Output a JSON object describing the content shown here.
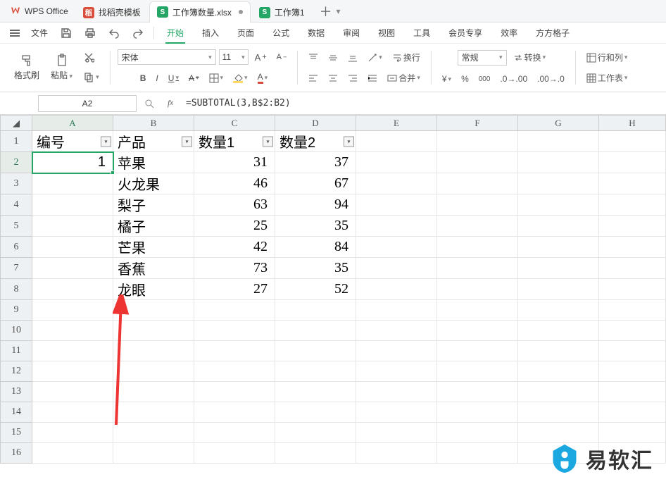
{
  "app_brand": "WPS Office",
  "tabs": [
    {
      "icon_bg": "#d94b3b",
      "icon_txt": "稻",
      "label": "找稻壳模板",
      "active": false,
      "modified": false
    },
    {
      "icon_bg": "#22a565",
      "icon_txt": "S",
      "label": "工作簿数量.xlsx",
      "active": true,
      "modified": true
    },
    {
      "icon_bg": "#22a565",
      "icon_txt": "S",
      "label": "工作簿1",
      "active": false,
      "modified": false
    }
  ],
  "menu": {
    "file": "文件",
    "ribbon": [
      "开始",
      "插入",
      "页面",
      "公式",
      "数据",
      "审阅",
      "视图",
      "工具",
      "会员专享",
      "效率",
      "方方格子"
    ],
    "active_ribbon": "开始"
  },
  "toolbar": {
    "format_painter": "格式刷",
    "paste": "粘贴",
    "font": "宋体",
    "size": "11",
    "wrap": "换行",
    "merge": "合并",
    "normal": "常规",
    "convert": "转换",
    "rowcol": "行和列",
    "worksheet": "工作表"
  },
  "formula": {
    "cell": "A2",
    "fx": "=SUBTOTAL(3,B$2:B2)"
  },
  "columns": [
    "A",
    "B",
    "C",
    "D",
    "E",
    "F",
    "G",
    "H"
  ],
  "headers": {
    "a": "编号",
    "b": "产品",
    "c": "数量1",
    "d": "数量2"
  },
  "rows": [
    {
      "a": "1",
      "b": "苹果",
      "c": "31",
      "d": "37"
    },
    {
      "a": "",
      "b": "火龙果",
      "c": "46",
      "d": "67"
    },
    {
      "a": "",
      "b": "梨子",
      "c": "63",
      "d": "94"
    },
    {
      "a": "",
      "b": "橘子",
      "c": "25",
      "d": "35"
    },
    {
      "a": "",
      "b": "芒果",
      "c": "42",
      "d": "84"
    },
    {
      "a": "",
      "b": "香蕉",
      "c": "73",
      "d": "35"
    },
    {
      "a": "",
      "b": "龙眼",
      "c": "27",
      "d": "52"
    }
  ],
  "overlay": "易软汇",
  "chart_data": {
    "type": "table",
    "columns": [
      "编号",
      "产品",
      "数量1",
      "数量2"
    ],
    "data": [
      [
        1,
        "苹果",
        31,
        37
      ],
      [
        null,
        "火龙果",
        46,
        67
      ],
      [
        null,
        "梨子",
        63,
        94
      ],
      [
        null,
        "橘子",
        25,
        35
      ],
      [
        null,
        "芒果",
        42,
        84
      ],
      [
        null,
        "香蕉",
        73,
        35
      ],
      [
        null,
        "龙眼",
        27,
        52
      ]
    ]
  }
}
